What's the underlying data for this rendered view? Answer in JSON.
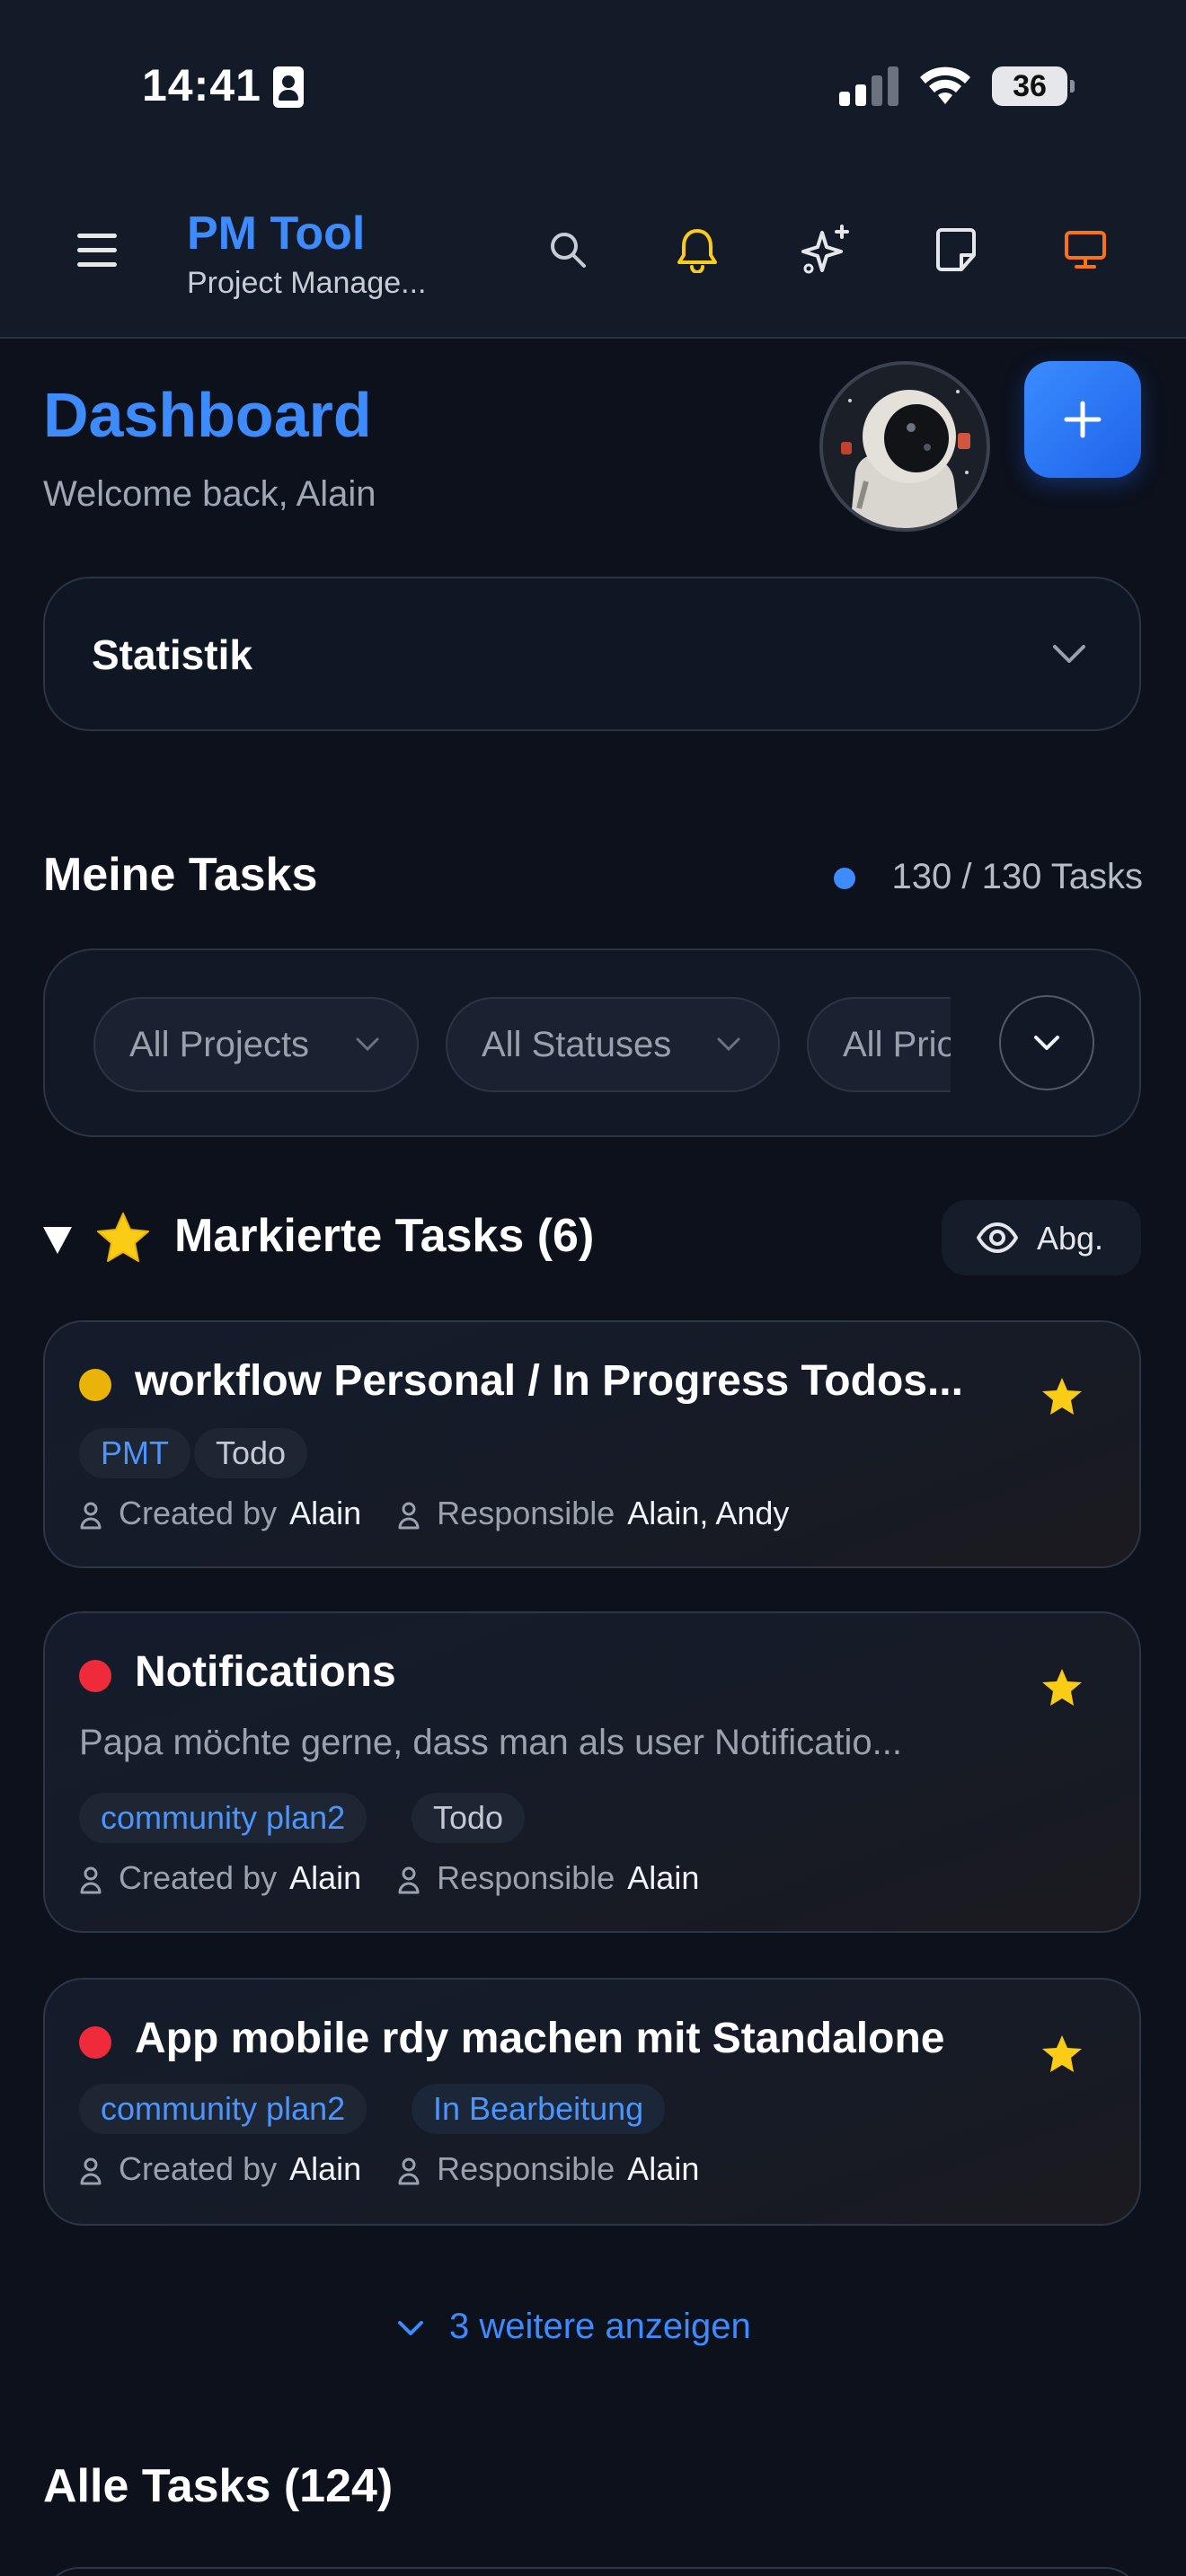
{
  "status_bar": {
    "time": "14:41",
    "battery": "36"
  },
  "header": {
    "title": "PM Tool",
    "subtitle": "Project Manage...",
    "icons": [
      "menu-icon",
      "search-icon",
      "bell-icon",
      "sparkles-icon",
      "note-icon",
      "monitor-icon"
    ],
    "colors": {
      "bell": "#facc15",
      "monitor": "#f97316",
      "accent": "#3d8bfd"
    }
  },
  "dashboard": {
    "title": "Dashboard",
    "welcome": "Welcome back, Alain",
    "statistik_label": "Statistik"
  },
  "my_tasks": {
    "title": "Meine Tasks",
    "count": "130 / 130 Tasks",
    "filters": [
      "All Projects",
      "All Statuses",
      "All Prio"
    ]
  },
  "marked": {
    "title": "Markierte Tasks (6)",
    "hide_label": "Abg.",
    "tasks": [
      {
        "title": "workflow Personal / In Progress Todos...",
        "description": "",
        "priority_color": "#eab308",
        "project": "PMT",
        "status": "Todo",
        "created_by_label": "Created by",
        "created_by": "Alain",
        "responsible_label": "Responsible",
        "responsible": "Alain, Andy"
      },
      {
        "title": "Notifications",
        "description": "Papa möchte gerne, dass man als user Notificatio...",
        "priority_color": "#ef2b3b",
        "project": "community plan2",
        "status": "Todo",
        "created_by_label": "Created by",
        "created_by": "Alain",
        "responsible_label": "Responsible",
        "responsible": "Alain"
      },
      {
        "title": "App mobile rdy machen mit Standalone",
        "description": "",
        "priority_color": "#ef2b3b",
        "project": "community plan2",
        "status": "In Bearbeitung",
        "created_by_label": "Created by",
        "created_by": "Alain",
        "responsible_label": "Responsible",
        "responsible": "Alain"
      }
    ],
    "show_more": "3 weitere anzeigen"
  },
  "all_tasks": {
    "title": "Alle Tasks (124)"
  }
}
